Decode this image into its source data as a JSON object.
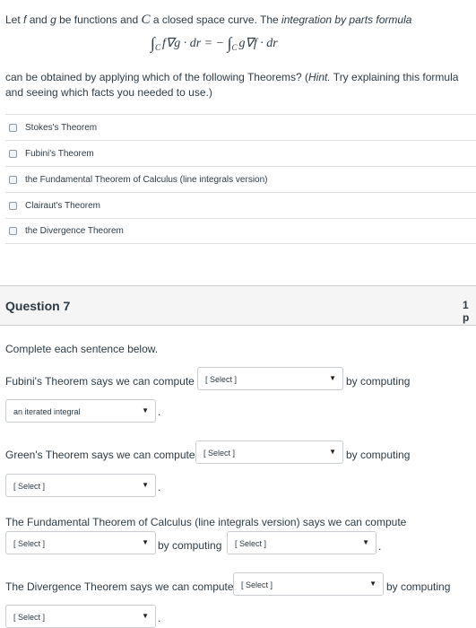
{
  "intro": {
    "part1": "Let ",
    "f": "f",
    "part2": " and ",
    "g": "g",
    "part3": " be functions and ",
    "C": "C",
    "part4": " a closed space curve. The ",
    "formula_term": "integration by parts formula"
  },
  "formula": {
    "int1": "∫",
    "sub1": "C",
    "lhs": "f∇g · dr = −",
    "int2": "∫",
    "sub2": "C",
    "rhs": "g∇f · dr"
  },
  "question_text": {
    "main": "can be obtained by applying which of the following Theorems? (",
    "hint": "Hint.",
    "rest": " Try explaining this formula and seeing which facts you needed to use.)"
  },
  "options": [
    "Stokes's Theorem",
    "Fubini's Theorem",
    "the Fundamental Theorem of Calculus (line integrals version)",
    "Clairaut's Theorem",
    "the Divergence Theorem"
  ],
  "question7": {
    "title": "Question 7",
    "points": "1 p",
    "instruction": "Complete each sentence below.",
    "s1_text": "Fubini's Theorem says we can compute",
    "s1_sel1": "[ Select ]",
    "s1_by": "by computing",
    "s1_sel2": "an iterated integral",
    "s2_text": "Green's Theorem says we can compute",
    "s2_sel1": "[ Select ]",
    "s2_by": "by computing",
    "s2_sel2": "[ Select ]",
    "s3_text": "The Fundamental Theorem of Calculus (line integrals version) says we can compute",
    "s3_sel1": "[ Select ]",
    "s3_by": "by computing",
    "s3_sel2": "[ Select ]",
    "s4_text": "The Divergence Theorem says we can compute",
    "s4_sel1": "[ Select ]",
    "s4_by": "by computing",
    "s4_sel2": "[ Select ]",
    "period": ".",
    "arrow": "▼"
  }
}
